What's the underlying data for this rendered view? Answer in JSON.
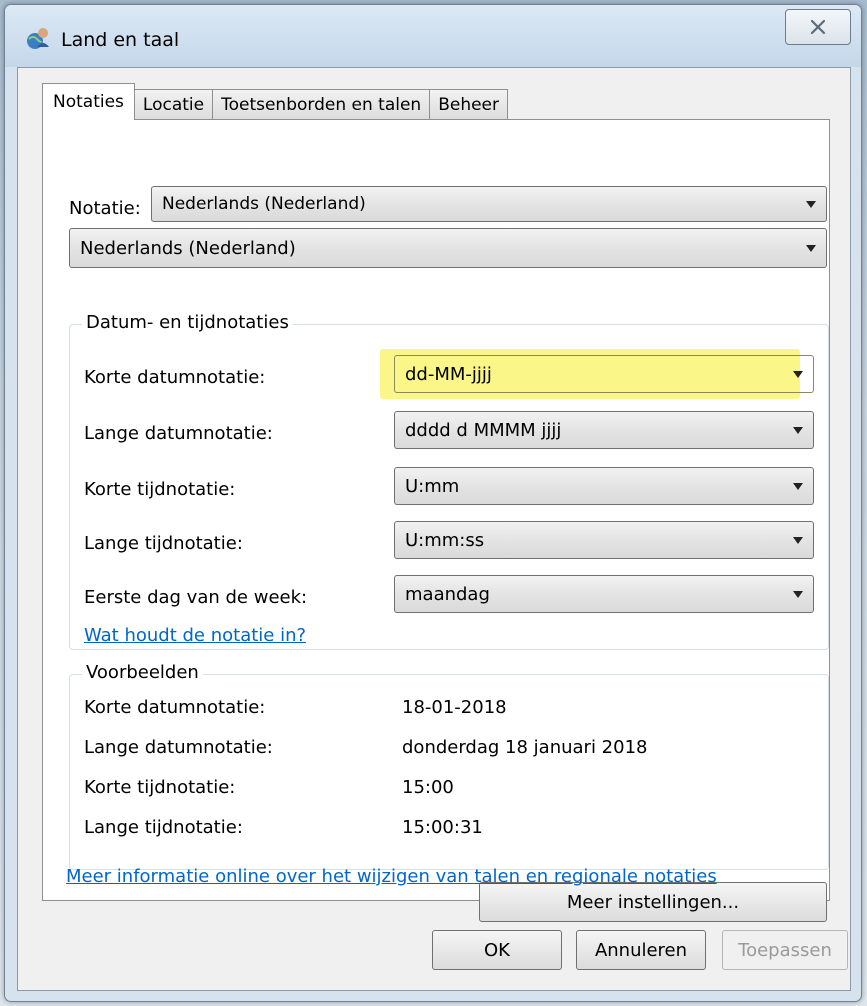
{
  "window": {
    "title": "Land en taal"
  },
  "tabs": [
    {
      "label": "Notaties",
      "active": true
    },
    {
      "label": "Locatie",
      "active": false
    },
    {
      "label": "Toetsenborden en talen",
      "active": false
    },
    {
      "label": "Beheer",
      "active": false
    }
  ],
  "notatie": {
    "label": "Notatie:",
    "selected": "Nederlands (Nederland)",
    "selected_large": "Nederlands (Nederland)"
  },
  "formats_group": {
    "title": "Datum- en tijdnotaties",
    "rows": [
      {
        "label": "Korte datumnotatie:",
        "value": "dd-MM-jjjj",
        "highlighted": true
      },
      {
        "label": "Lange datumnotatie:",
        "value": "dddd d MMMM jjjj"
      },
      {
        "label": "Korte tijdnotatie:",
        "value": "U:mm"
      },
      {
        "label": "Lange tijdnotatie:",
        "value": "U:mm:ss"
      },
      {
        "label": "Eerste dag van de week:",
        "value": "maandag"
      }
    ],
    "help_link": "Wat houdt de notatie in?"
  },
  "examples_group": {
    "title": "Voorbeelden",
    "rows": [
      {
        "label": "Korte datumnotatie:",
        "value": "18-01-2018"
      },
      {
        "label": "Lange datumnotatie:",
        "value": "donderdag 18 januari 2018"
      },
      {
        "label": "Korte tijdnotatie:",
        "value": "15:00"
      },
      {
        "label": "Lange tijdnotatie:",
        "value": "15:00:31"
      }
    ]
  },
  "buttons": {
    "more_settings": "Meer instellingen...",
    "ok": "OK",
    "cancel": "Annuleren",
    "apply": "Toepassen"
  },
  "info_link": "Meer informatie online over het wijzigen van talen en regionale notaties",
  "colors": {
    "highlight": "#f9f57a",
    "link": "#0066cc"
  }
}
